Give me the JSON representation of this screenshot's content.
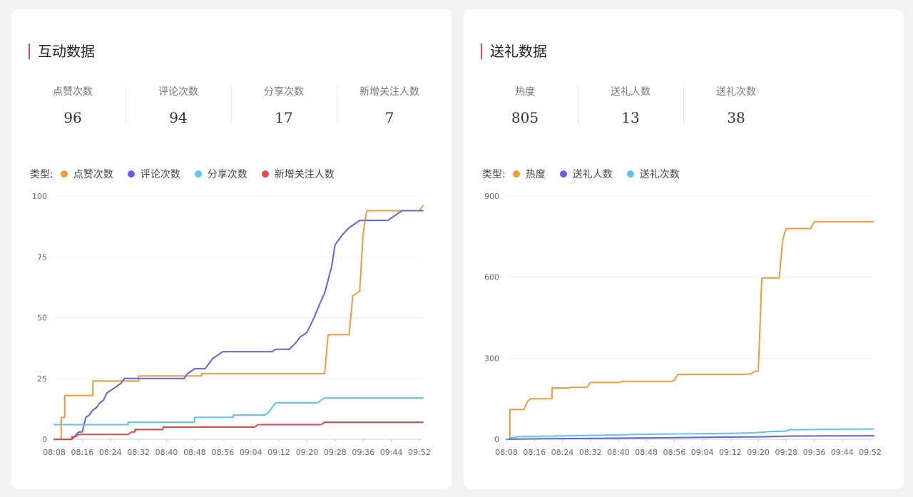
{
  "interaction": {
    "title": "互动数据",
    "stats": [
      {
        "label": "点赞次数",
        "value": "96"
      },
      {
        "label": "评论次数",
        "value": "94"
      },
      {
        "label": "分享次数",
        "value": "17"
      },
      {
        "label": "新增关注人数",
        "value": "7"
      }
    ],
    "legend_title": "类型:"
  },
  "gifts": {
    "title": "送礼数据",
    "stats": [
      {
        "label": "热度",
        "value": "805"
      },
      {
        "label": "送礼人数",
        "value": "13"
      },
      {
        "label": "送礼次数",
        "value": "38"
      }
    ],
    "legend_title": "类型:"
  },
  "chart_data": [
    {
      "type": "line",
      "x_ticks": [
        "08:08",
        "08:16",
        "08:24",
        "08:32",
        "08:40",
        "08:48",
        "08:56",
        "09:04",
        "09:12",
        "09:20",
        "09:28",
        "09:36",
        "09:44",
        "09:52"
      ],
      "y_ticks": [
        0,
        25,
        50,
        75,
        100
      ],
      "ylim": [
        0,
        100
      ],
      "grid": true,
      "legend_position": "top-left",
      "series": [
        {
          "name": "点赞次数",
          "color": "#f59a36",
          "step": true,
          "points": [
            [
              "08:08",
              0
            ],
            [
              "08:10",
              0
            ],
            [
              "08:10",
              9
            ],
            [
              "08:11",
              9
            ],
            [
              "08:11",
              18
            ],
            [
              "08:19",
              18
            ],
            [
              "08:19",
              24
            ],
            [
              "08:32",
              24
            ],
            [
              "08:32",
              26
            ],
            [
              "08:50",
              26
            ],
            [
              "08:50",
              27
            ],
            [
              "09:25",
              27
            ],
            [
              "09:26",
              43
            ],
            [
              "09:32",
              43
            ],
            [
              "09:33",
              59
            ],
            [
              "09:34",
              60
            ],
            [
              "09:35",
              61
            ],
            [
              "09:36",
              85
            ],
            [
              "09:37",
              94
            ],
            [
              "09:52",
              94
            ],
            [
              "09:53",
              96
            ]
          ]
        },
        {
          "name": "评论次数",
          "color": "#6060e6",
          "step": false,
          "points": [
            [
              "08:08",
              0
            ],
            [
              "08:13",
              0
            ],
            [
              "08:15",
              3
            ],
            [
              "08:16",
              3
            ],
            [
              "08:17",
              9
            ],
            [
              "08:18",
              10
            ],
            [
              "08:19",
              12
            ],
            [
              "08:20",
              13
            ],
            [
              "08:21",
              15
            ],
            [
              "08:22",
              16
            ],
            [
              "08:23",
              19
            ],
            [
              "08:25",
              21
            ],
            [
              "08:27",
              23
            ],
            [
              "08:28",
              25
            ],
            [
              "08:40",
              25
            ],
            [
              "08:45",
              25
            ],
            [
              "08:46",
              27
            ],
            [
              "08:47",
              28
            ],
            [
              "08:48",
              29
            ],
            [
              "08:51",
              29
            ],
            [
              "08:52",
              31
            ],
            [
              "08:53",
              33
            ],
            [
              "08:54",
              34
            ],
            [
              "08:56",
              36
            ],
            [
              "09:05",
              36
            ],
            [
              "09:10",
              36
            ],
            [
              "09:11",
              37
            ],
            [
              "09:15",
              37
            ],
            [
              "09:17",
              40
            ],
            [
              "09:18",
              42
            ],
            [
              "09:20",
              44
            ],
            [
              "09:22",
              50
            ],
            [
              "09:24",
              57
            ],
            [
              "09:25",
              60
            ],
            [
              "09:27",
              71
            ],
            [
              "09:28",
              80
            ],
            [
              "09:30",
              84
            ],
            [
              "09:32",
              87
            ],
            [
              "09:34",
              89
            ],
            [
              "09:35",
              90
            ],
            [
              "09:43",
              90
            ],
            [
              "09:45",
              92
            ],
            [
              "09:47",
              94
            ],
            [
              "09:53",
              94
            ]
          ]
        },
        {
          "name": "分享次数",
          "color": "#5bc6f2",
          "step": true,
          "points": [
            [
              "08:08",
              6
            ],
            [
              "08:29",
              6
            ],
            [
              "08:29",
              7
            ],
            [
              "08:48",
              7
            ],
            [
              "08:48",
              9
            ],
            [
              "08:59",
              9
            ],
            [
              "08:59",
              10
            ],
            [
              "09:08",
              10
            ],
            [
              "09:09",
              11
            ],
            [
              "09:10",
              13
            ],
            [
              "09:11",
              15
            ],
            [
              "09:23",
              15
            ],
            [
              "09:24",
              16
            ],
            [
              "09:25",
              17
            ],
            [
              "09:53",
              17
            ]
          ]
        },
        {
          "name": "新增关注人数",
          "color": "#e74646",
          "step": true,
          "points": [
            [
              "08:08",
              0
            ],
            [
              "08:13",
              0
            ],
            [
              "08:13",
              1
            ],
            [
              "08:14",
              1
            ],
            [
              "08:15",
              2
            ],
            [
              "08:29",
              2
            ],
            [
              "08:30",
              3
            ],
            [
              "08:31",
              3
            ],
            [
              "08:31",
              4
            ],
            [
              "08:39",
              4
            ],
            [
              "08:39",
              5
            ],
            [
              "09:05",
              5
            ],
            [
              "09:06",
              6
            ],
            [
              "09:24",
              6
            ],
            [
              "09:25",
              7
            ],
            [
              "09:53",
              7
            ]
          ]
        }
      ]
    },
    {
      "type": "line",
      "x_ticks": [
        "08:08",
        "08:16",
        "08:24",
        "08:32",
        "08:40",
        "08:48",
        "08:56",
        "09:04",
        "09:12",
        "09:20",
        "09:28",
        "09:36",
        "09:44",
        "09:52"
      ],
      "y_ticks": [
        0,
        300,
        600,
        900
      ],
      "ylim": [
        0,
        900
      ],
      "grid": true,
      "legend_position": "top-left",
      "series": [
        {
          "name": "热度",
          "color": "#f59a36",
          "step": true,
          "points": [
            [
              "08:08",
              0
            ],
            [
              "08:09",
              0
            ],
            [
              "08:09",
              110
            ],
            [
              "08:13",
              110
            ],
            [
              "08:14",
              140
            ],
            [
              "08:15",
              150
            ],
            [
              "08:21",
              150
            ],
            [
              "08:21",
              190
            ],
            [
              "08:26",
              190
            ],
            [
              "08:26",
              192
            ],
            [
              "08:31",
              192
            ],
            [
              "08:32",
              210
            ],
            [
              "08:40",
              210
            ],
            [
              "08:41",
              214
            ],
            [
              "08:55",
              214
            ],
            [
              "08:56",
              218
            ],
            [
              "08:57",
              240
            ],
            [
              "09:15",
              240
            ],
            [
              "09:18",
              242
            ],
            [
              "09:19",
              252
            ],
            [
              "09:20",
              252
            ],
            [
              "09:21",
              597
            ],
            [
              "09:26",
              597
            ],
            [
              "09:27",
              740
            ],
            [
              "09:28",
              780
            ],
            [
              "09:35",
              780
            ],
            [
              "09:36",
              805
            ],
            [
              "09:53",
              805
            ]
          ]
        },
        {
          "name": "送礼人数",
          "color": "#6060e6",
          "step": false,
          "points": [
            [
              "08:08",
              0
            ],
            [
              "08:20",
              2
            ],
            [
              "08:40",
              4
            ],
            [
              "08:56",
              6
            ],
            [
              "09:20",
              9
            ],
            [
              "09:30",
              12
            ],
            [
              "09:53",
              13
            ]
          ]
        },
        {
          "name": "送礼次数",
          "color": "#5bc6f2",
          "step": true,
          "points": [
            [
              "08:08",
              0
            ],
            [
              "08:09",
              5
            ],
            [
              "08:12",
              10
            ],
            [
              "08:22",
              12
            ],
            [
              "08:30",
              14
            ],
            [
              "08:40",
              16
            ],
            [
              "08:45",
              18
            ],
            [
              "09:12",
              22
            ],
            [
              "09:19",
              24
            ],
            [
              "09:23",
              28
            ],
            [
              "09:28",
              30
            ],
            [
              "09:29",
              35
            ],
            [
              "09:40",
              37
            ],
            [
              "09:53",
              38
            ]
          ]
        }
      ]
    }
  ]
}
